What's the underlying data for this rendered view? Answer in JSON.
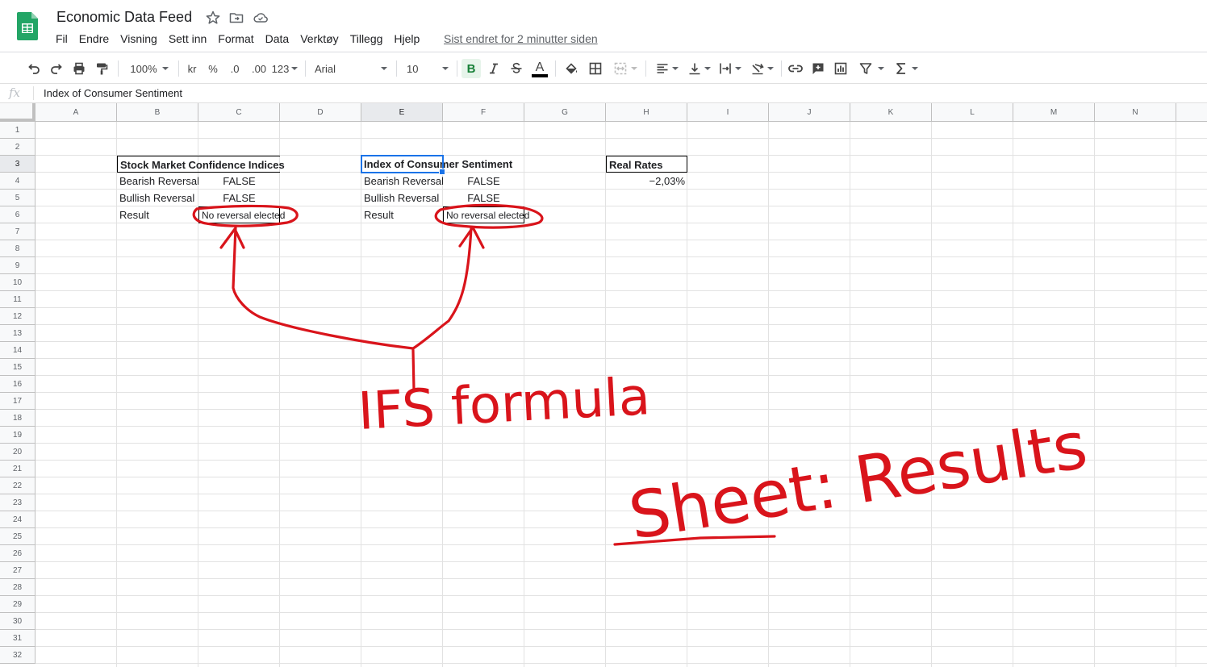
{
  "app": {
    "doc_title": "Economic Data Feed",
    "last_edit": "Sist endret for 2 minutter siden",
    "menu": [
      "Fil",
      "Endre",
      "Visning",
      "Sett inn",
      "Format",
      "Data",
      "Verktøy",
      "Tillegg",
      "Hjelp"
    ]
  },
  "toolbar": {
    "zoom": "100%",
    "currency": "kr",
    "percent": "%",
    "dec_decrease": ".0",
    "dec_increase": ".00",
    "more_formats": "123",
    "font": "Arial",
    "font_size": "10",
    "bold": "B",
    "text_color": "A",
    "accent": "#188038"
  },
  "formula_bar": {
    "fx": "fx",
    "content": "Index of Consumer Sentiment"
  },
  "columns": [
    "A",
    "B",
    "C",
    "D",
    "E",
    "F",
    "G",
    "H",
    "I",
    "J",
    "K",
    "L",
    "M",
    "N"
  ],
  "rows": [
    "1",
    "2",
    "3",
    "4",
    "5",
    "6",
    "7",
    "8",
    "9",
    "10",
    "11",
    "12",
    "13",
    "14",
    "15",
    "16",
    "17",
    "18",
    "19",
    "20",
    "21",
    "22",
    "23",
    "24",
    "25",
    "26",
    "27",
    "28",
    "29",
    "30",
    "31",
    "32"
  ],
  "cells": {
    "B3": "Stock Market Confidence Indices",
    "B4": "Bearish Reversal",
    "C4": "FALSE",
    "B5": "Bullish Reversal",
    "C5": "FALSE",
    "B6": "Result",
    "C6": "No reversal elected",
    "E3": "Index of Consumer Sentiment",
    "E4": "Bearish Reversal",
    "F4": "FALSE",
    "E5": "Bullish Reversal",
    "F5": "FALSE",
    "E6": "Result",
    "F6": "No reversal elected",
    "H3": "Real Rates",
    "H4": "−2,03%"
  },
  "annotations": {
    "label_1": "IFS formula",
    "label_2": "Sheet: Results",
    "ink_color": "#d9141b"
  }
}
